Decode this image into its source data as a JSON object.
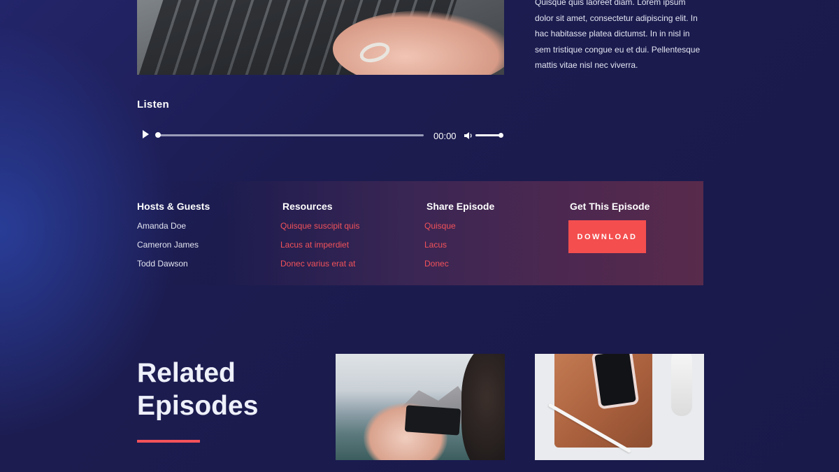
{
  "episode": {
    "description": "Quisque quis laoreet diam. Lorem ipsum dolor sit amet, consectetur adipiscing elit. In hac habitasse platea dictumst. In in nisl in sem tristique congue eu et dui. Pellentesque mattis vitae nisl nec viverra."
  },
  "player": {
    "heading": "Listen",
    "time": "00:00",
    "progress_fraction": 0.0,
    "volume_fraction": 1.0
  },
  "info": {
    "hosts": {
      "heading": "Hosts & Guests",
      "items": [
        "Amanda Doe",
        "Cameron James",
        "Todd Dawson"
      ]
    },
    "resources": {
      "heading": "Resources",
      "items": [
        "Quisque suscipit quis",
        "Lacus at imperdiet",
        "Donec varius erat at"
      ]
    },
    "share": {
      "heading": "Share Episode",
      "items": [
        "Quisque",
        "Lacus",
        "Donec"
      ]
    },
    "get": {
      "heading": "Get This Episode",
      "button": "DOWNLOAD"
    }
  },
  "related": {
    "line1": "Related",
    "line2": "Episodes"
  },
  "colors": {
    "background": "#1b1b4a",
    "accent": "#f2525a",
    "button": "#f44e4e"
  },
  "icons": [
    "play-icon",
    "volume-icon"
  ]
}
